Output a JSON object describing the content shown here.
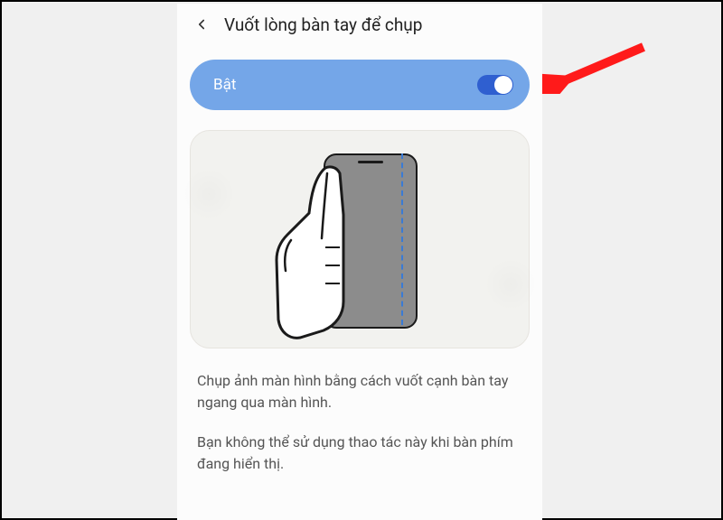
{
  "header": {
    "title": "Vuốt lòng bàn tay để chụp"
  },
  "toggle": {
    "label": "Bật",
    "state": "on"
  },
  "description": {
    "p1": "Chụp ảnh màn hình bằng cách vuốt cạnh bàn tay ngang qua màn hình.",
    "p2": "Bạn không thể sử dụng thao tác này khi bàn phím đang hiển thị."
  },
  "icons": {
    "back": "chevron-left-icon",
    "annotation": "attention-arrow"
  },
  "colors": {
    "accent": "#74a6e8",
    "switch_track": "#2f5fd0",
    "arrow": "#ff1a1a"
  }
}
